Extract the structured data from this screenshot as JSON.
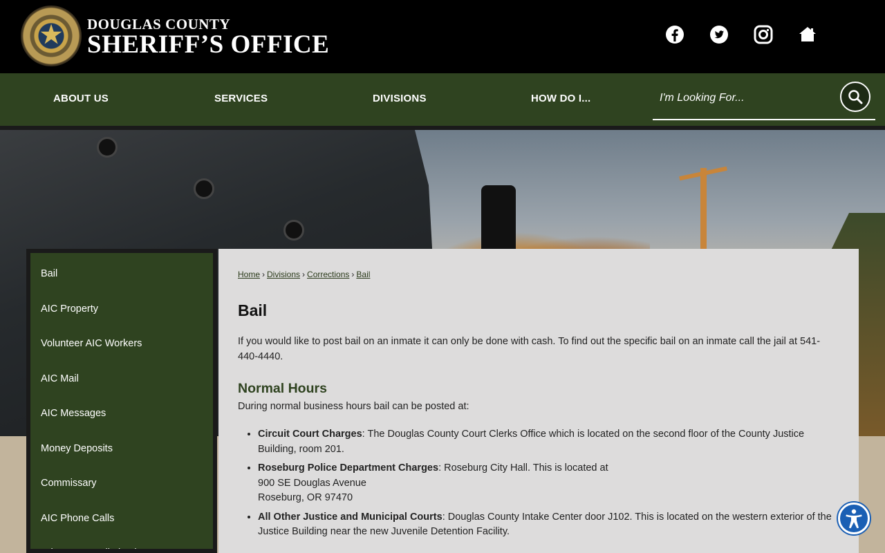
{
  "header": {
    "logo_line1": "DOUGLAS COUNTY",
    "logo_line2": "SHERIFF’S OFFICE",
    "social": [
      "facebook-icon",
      "twitter-icon",
      "instagram-icon",
      "home-icon"
    ]
  },
  "nav": {
    "items": [
      "ABOUT US",
      "SERVICES",
      "DIVISIONS",
      "HOW DO I..."
    ],
    "search_placeholder": "I'm Looking For..."
  },
  "sidebar": {
    "items": [
      "Bail",
      "AIC Property",
      "Volunteer AIC Workers",
      "AIC Mail",
      "AIC Messages",
      "Money Deposits",
      "Commissary",
      "AIC Phone Calls",
      "Prison Rape Elimination Act"
    ]
  },
  "breadcrumb": [
    "Home",
    "Divisions",
    "Corrections",
    "Bail"
  ],
  "page": {
    "title": "Bail",
    "intro": "If you would like to post bail on an inmate it can only be done with cash. To find out the specific bail on an inmate call the jail at 541-440-4440.",
    "section_title": "Normal Hours",
    "section_lead": "During normal business hours bail can be posted at:",
    "list": [
      {
        "label": "Circuit Court Charges",
        "text": ": The Douglas County Court Clerks Office which is located on the second floor of the County Justice Building, room 201."
      },
      {
        "label": "Roseburg Police Department Charges",
        "text": ": Roseburg City Hall. This is located at",
        "line2": "900 SE Douglas Avenue",
        "line3": "Roseburg, OR 97470"
      },
      {
        "label": "All Other Justice and Municipal Courts",
        "text": ": Douglas County Intake Center door J102. This is located on the western exterior of the Justice Building near the new Juvenile Detention Facility."
      }
    ]
  },
  "colors": {
    "nav_green": "#2f4320",
    "heading_green": "#2f4320",
    "content_bg": "#dddcdc"
  }
}
